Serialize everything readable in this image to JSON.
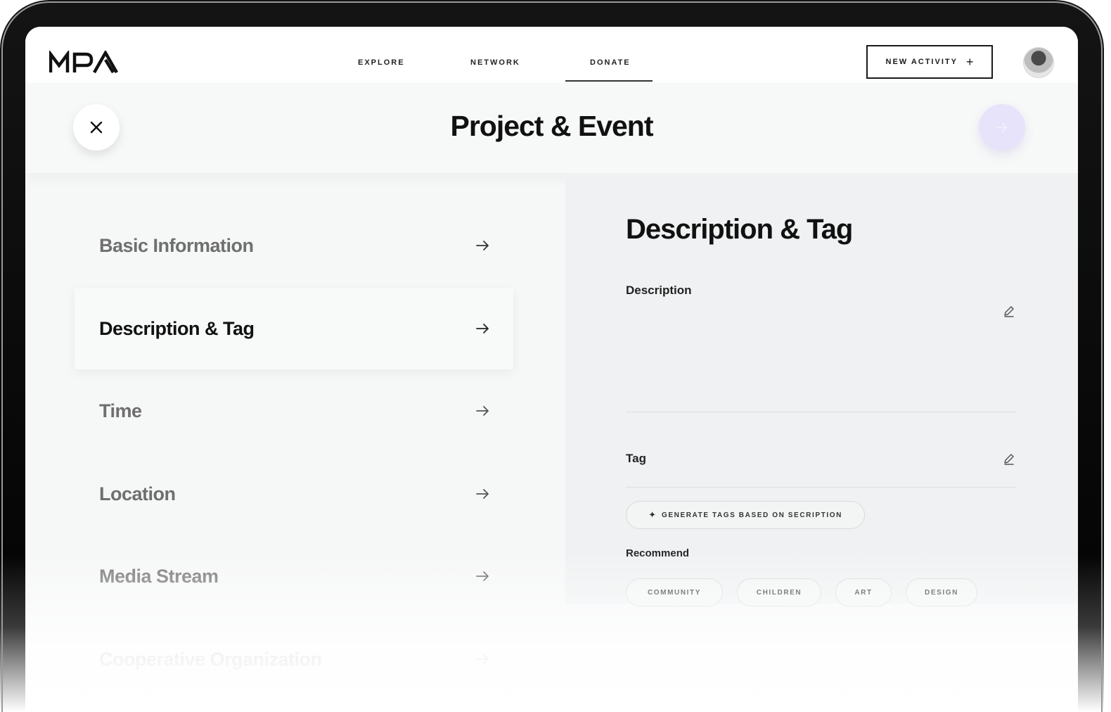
{
  "app": {
    "logo_text": "MPA"
  },
  "nav": {
    "items": [
      {
        "label": "EXPLORE"
      },
      {
        "label": "NETWORK"
      },
      {
        "label": "DONATE",
        "active": true
      }
    ],
    "new_activity_label": "NEW ACTIVITY",
    "new_activity_icon": "+"
  },
  "header": {
    "title": "Project & Event"
  },
  "sidebar": {
    "items": [
      {
        "label": "Basic Information"
      },
      {
        "label": "Description & Tag",
        "active": true
      },
      {
        "label": "Time"
      },
      {
        "label": "Location"
      },
      {
        "label": "Media Stream"
      },
      {
        "label": "Cooperative Organization"
      }
    ]
  },
  "panel": {
    "title": "Description & Tag",
    "description_label": "Description",
    "tag_label": "Tag",
    "generate_button_label": "GENERATE TAGS BASED ON SECRIPTION",
    "recommend_label": "Recommend",
    "recommend_tags": [
      "COMMUNITY",
      "CHILDREN",
      "ART",
      "DESIGN"
    ]
  },
  "colors": {
    "accent_light": "#e7e3fb",
    "text_dark": "#111111",
    "text_muted": "#6f6f6f",
    "panel_bg": "#eff1f2"
  },
  "icons": [
    "close-icon",
    "arrow-right-icon",
    "edit-pencil-icon",
    "sparkle-icon",
    "plus-icon"
  ]
}
